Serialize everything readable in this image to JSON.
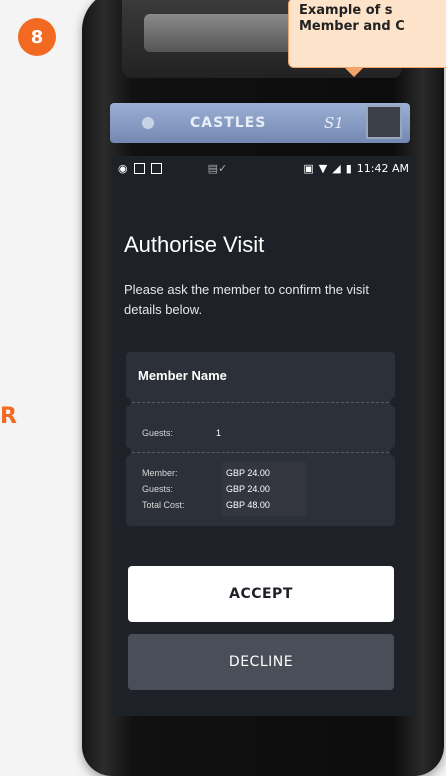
{
  "step": {
    "number": "8"
  },
  "side_letter": "R",
  "callout": {
    "line1": "Example of s",
    "line2": "Member and C"
  },
  "device": {
    "brand": "CASTLES",
    "model": "S1"
  },
  "status_bar": {
    "time": "11:42 AM"
  },
  "screen": {
    "title": "Authorise Visit",
    "subtitle": "Please ask the member to confirm the visit details below.",
    "member_name": "Member Name",
    "guests_label": "Guests:",
    "guests_value": "1",
    "cost": {
      "member_label": "Member:",
      "member_value": "GBP 24.00",
      "guests_label": "Guests:",
      "guests_value": "GBP 24.00",
      "total_label": "Total Cost:",
      "total_value": "GBP 48.00"
    },
    "accept_label": "ACCEPT",
    "decline_label": "DECLINE"
  },
  "colors": {
    "accent": "#f26a21",
    "screen_bg": "#1e2128",
    "card_bg": "#2c3038"
  }
}
